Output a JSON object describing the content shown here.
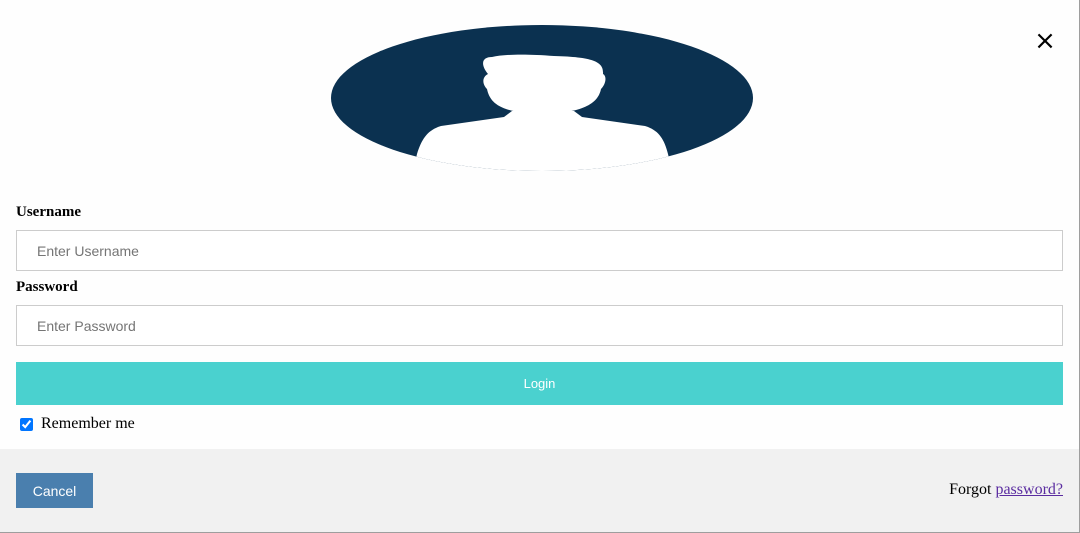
{
  "close_glyph": "×",
  "avatar": {
    "icon": "user-avatar-icon",
    "color": "#0b3150"
  },
  "form": {
    "username_label": "Username",
    "username_placeholder": "Enter Username",
    "username_value": "",
    "password_label": "Password",
    "password_placeholder": "Enter Password",
    "password_value": "",
    "login_label": "Login",
    "remember_label": "Remember me",
    "remember_checked": true
  },
  "footer": {
    "cancel_label": "Cancel",
    "forgot_prefix": "Forgot",
    "forgot_link": "password?"
  },
  "colors": {
    "login_button": "#4ad1cf",
    "cancel_button": "#4a7fae",
    "footer_bg": "#f1f1f1",
    "link": "#5a2ca0"
  }
}
